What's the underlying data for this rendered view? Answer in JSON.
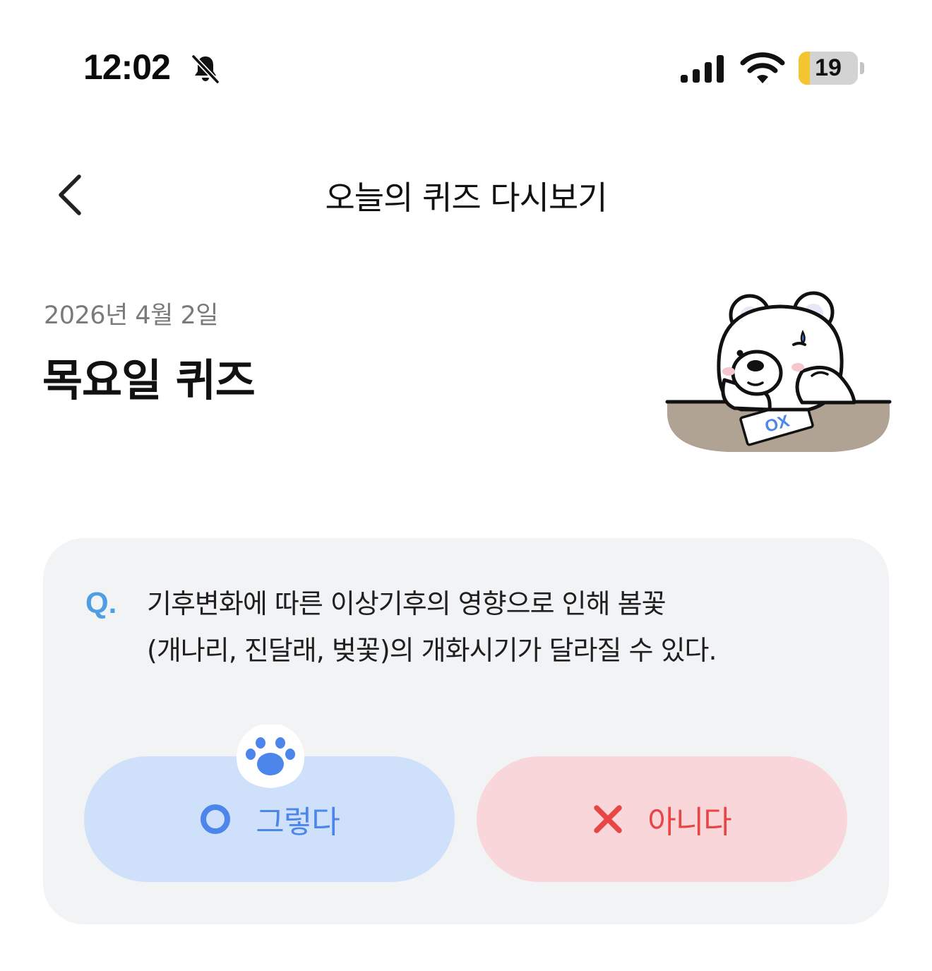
{
  "status_bar": {
    "time": "12:02",
    "battery_level": "19",
    "battery_fraction": 0.19
  },
  "header": {
    "title": "오늘의 퀴즈 다시보기"
  },
  "quiz": {
    "date": "2026년 4월 2일",
    "title": "목요일 퀴즈",
    "question_prefix": "Q.",
    "question_line1": "기후변화에 따른 이상기후의 영향으로 인해 봄꽃",
    "question_line2": "(개나리, 진달래, 벚꽃)의 개화시기가 달라질 수 있다.",
    "answers": {
      "yes_label": "그렇다",
      "no_label": "아니다"
    },
    "illustration_text": "OX"
  },
  "colors": {
    "card_background": "#f2f3f5",
    "yes_background": "#cfe0fa",
    "yes_accent": "#4d86ea",
    "no_background": "#f8d6da",
    "no_accent": "#e84545",
    "q_accent": "#4f9ee3",
    "battery_fill": "#f5c531"
  },
  "icons": [
    "bell-slash-icon",
    "cellular-signal-icon",
    "wifi-icon",
    "battery-icon",
    "back-chevron-icon",
    "circle-o-icon",
    "x-icon",
    "paw-icon"
  ]
}
